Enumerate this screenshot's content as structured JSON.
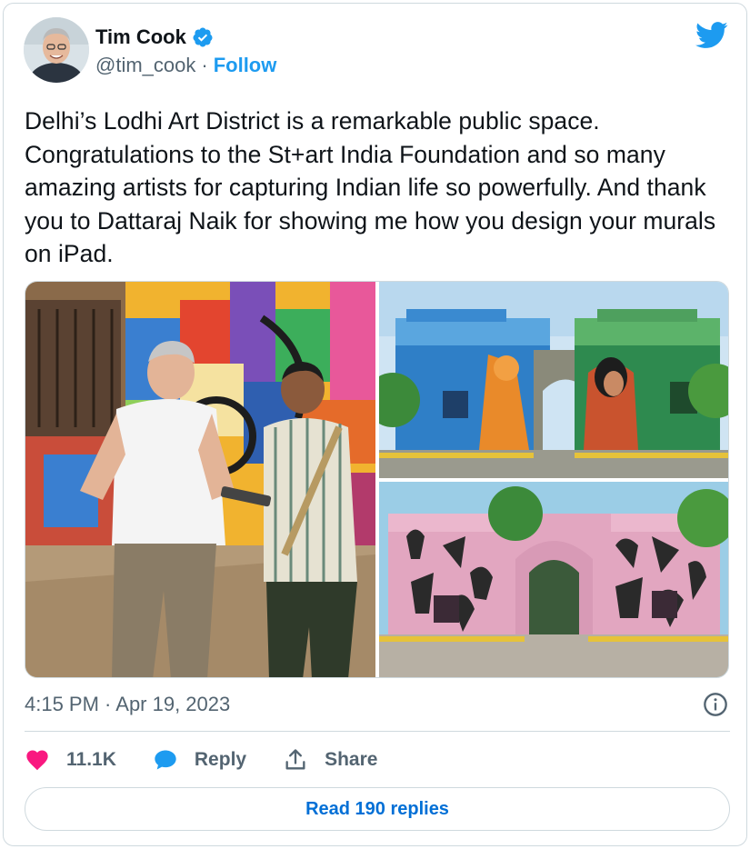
{
  "author": {
    "name": "Tim Cook",
    "handle": "@tim_cook",
    "separator": "·",
    "follow_label": "Follow"
  },
  "tweet": {
    "text": "Delhi’s Lodhi Art District is a remarkable public space. Congratulations to the St+art India Foundation and so many amazing artists for capturing Indian life so powerfully. And thank you to Dattaraj Naik for showing me how you design your murals on iPad.",
    "timestamp": "4:15 PM · Apr 19, 2023"
  },
  "stats": {
    "likes": "11.1K",
    "reply_label": "Reply",
    "share_label": "Share"
  },
  "read_replies_label": "Read 190 replies",
  "colors": {
    "brand_blue": "#1d9bf0",
    "like_pink": "#f91880",
    "muted_text": "#536471",
    "link_blue": "#006fd6"
  },
  "icons": [
    "verified-badge-icon",
    "twitter-bird-icon",
    "info-icon",
    "heart-icon",
    "reply-bubble-icon",
    "share-icon"
  ]
}
